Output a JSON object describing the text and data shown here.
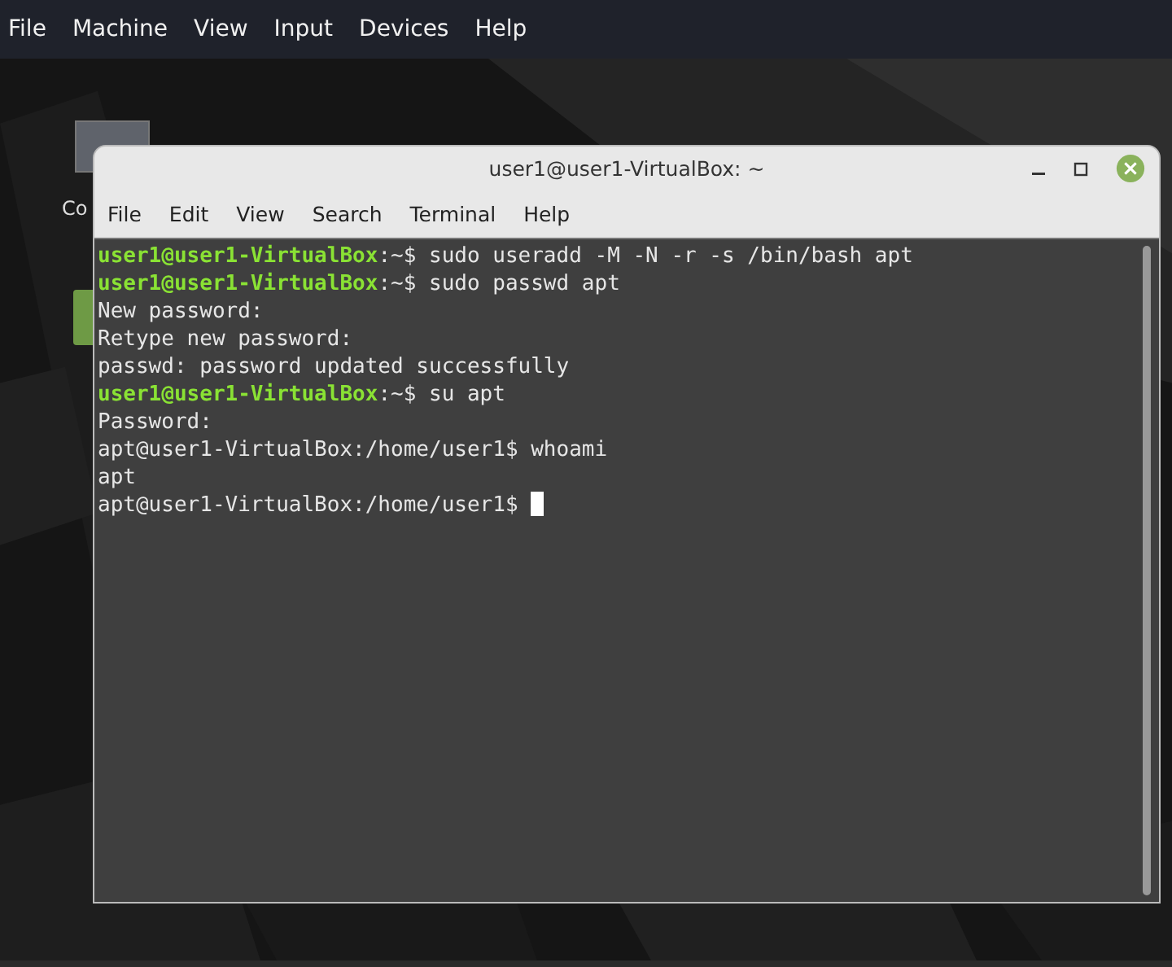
{
  "host_menu": [
    "File",
    "Machine",
    "View",
    "Input",
    "Devices",
    "Help"
  ],
  "desktop_icons": [
    {
      "label": "Co"
    }
  ],
  "window": {
    "title": "user1@user1-VirtualBox: ~",
    "menu": [
      "File",
      "Edit",
      "View",
      "Search",
      "Terminal",
      "Help"
    ]
  },
  "terminal": {
    "lines": [
      {
        "kind": "prompt",
        "user_host": "user1@user1-VirtualBox",
        "rest": ":~$ sudo useradd -M -N -r -s /bin/bash apt"
      },
      {
        "kind": "prompt",
        "user_host": "user1@user1-VirtualBox",
        "rest": ":~$ sudo passwd apt"
      },
      {
        "kind": "output",
        "text": "New password:"
      },
      {
        "kind": "output",
        "text": "Retype new password:"
      },
      {
        "kind": "output",
        "text": "passwd: password updated successfully"
      },
      {
        "kind": "prompt",
        "user_host": "user1@user1-VirtualBox",
        "rest": ":~$ su apt"
      },
      {
        "kind": "output",
        "text": "Password:"
      },
      {
        "kind": "output",
        "text": "apt@user1-VirtualBox:/home/user1$ whoami"
      },
      {
        "kind": "output",
        "text": "apt"
      },
      {
        "kind": "output",
        "text": "apt@user1-VirtualBox:/home/user1$ ",
        "cursor": true
      }
    ]
  }
}
